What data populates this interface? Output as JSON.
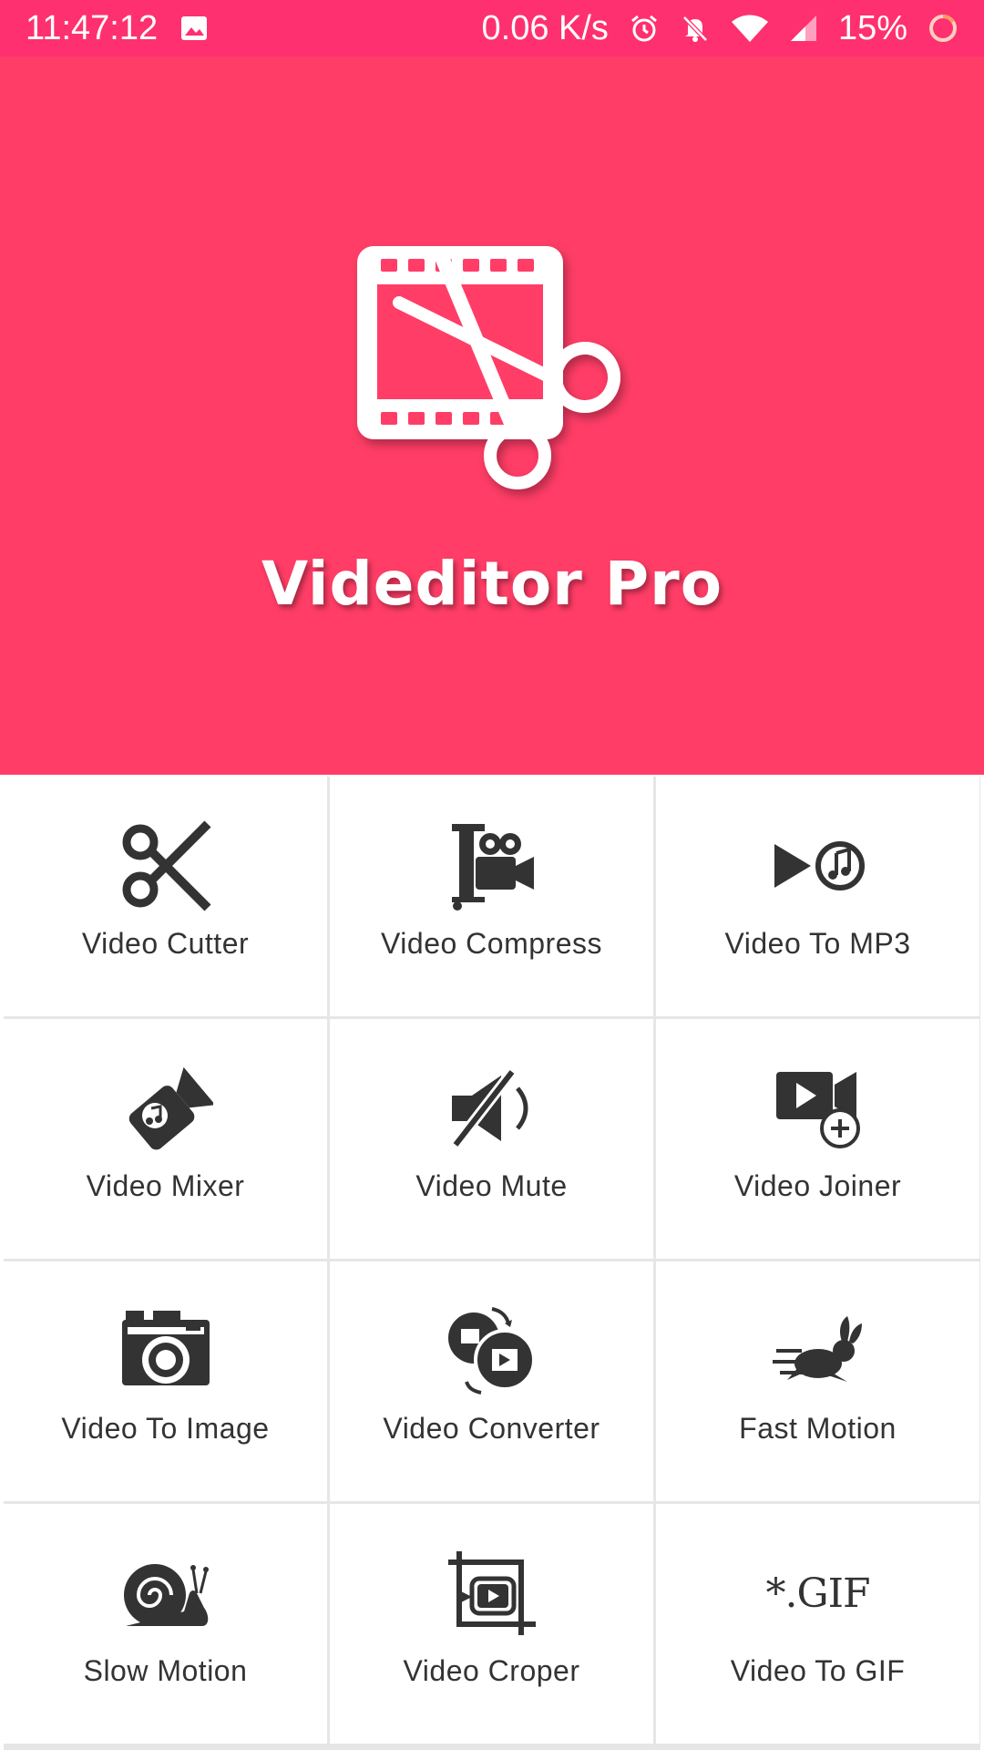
{
  "status_bar": {
    "time": "11:47:12",
    "network_speed": "0.06 K/s",
    "battery": "15%",
    "icons": [
      "image-icon",
      "alarm-icon",
      "notifications-off-icon",
      "wifi-icon",
      "signal-icon",
      "battery-ring-icon"
    ]
  },
  "header": {
    "app_name": "Videditor Pro",
    "logo_icon": "film-scissors-icon",
    "background_color": "#ff3d66",
    "status_bar_color": "#ff306f"
  },
  "tools": [
    {
      "label": "Video Cutter",
      "icon": "scissors-icon"
    },
    {
      "label": "Video Compress",
      "icon": "clamp-camera-icon"
    },
    {
      "label": "Video To MP3",
      "icon": "play-music-icon"
    },
    {
      "label": "Video Mixer",
      "icon": "camera-music-icon"
    },
    {
      "label": "Video Mute",
      "icon": "mute-icon"
    },
    {
      "label": "Video Joiner",
      "icon": "video-add-icon"
    },
    {
      "label": "Video To Image",
      "icon": "photo-camera-icon"
    },
    {
      "label": "Video Converter",
      "icon": "convert-video-icon"
    },
    {
      "label": "Fast Motion",
      "icon": "rabbit-icon"
    },
    {
      "label": "Slow Motion",
      "icon": "snail-icon"
    },
    {
      "label": "Video Croper",
      "icon": "crop-video-icon"
    },
    {
      "label": "Video To GIF",
      "icon": "gif-icon",
      "icon_text": "*.GIF"
    }
  ]
}
